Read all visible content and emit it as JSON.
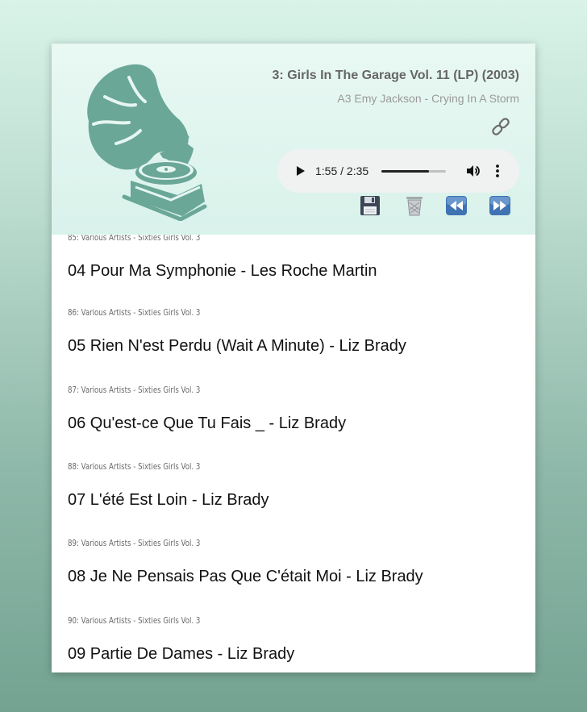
{
  "now_playing": {
    "album": "3: Girls In The Garage Vol. 11 (LP) (2003)",
    "track": "A3 Emy Jackson - Crying In A Storm"
  },
  "player": {
    "time": "1:55 / 2:35",
    "progress": 0.74
  },
  "icons": {
    "logo": "gramophone-logo",
    "link": "link-icon",
    "play": "play-icon",
    "volume": "volume-icon",
    "menu": "more-options-icon",
    "save": "floppy-disk-icon",
    "delete": "trash-icon",
    "previous": "rewind-icon",
    "next": "fast-forward-icon"
  },
  "colors": {
    "logo": "#6aa797",
    "header_bg": "#e6f6f1",
    "button_blue": "#3f73b3"
  },
  "playlist": [
    {
      "meta": "85: Various Artists - Sixties Girls Vol. 3",
      "title": "04 Pour Ma Symphonie - Les Roche Martin"
    },
    {
      "meta": "86: Various Artists - Sixties Girls Vol. 3",
      "title": "05 Rien N'est Perdu (Wait A Minute) - Liz Brady"
    },
    {
      "meta": "87: Various Artists - Sixties Girls Vol. 3",
      "title": "06 Qu'est-ce Que Tu Fais _ - Liz Brady"
    },
    {
      "meta": "88: Various Artists - Sixties Girls Vol. 3",
      "title": "07 L'été Est Loin - Liz Brady"
    },
    {
      "meta": "89: Various Artists - Sixties Girls Vol. 3",
      "title": "08 Je Ne Pensais Pas Que C'était Moi - Liz Brady"
    },
    {
      "meta": "90: Various Artists - Sixties Girls Vol. 3",
      "title": "09 Partie De Dames - Liz Brady"
    }
  ]
}
